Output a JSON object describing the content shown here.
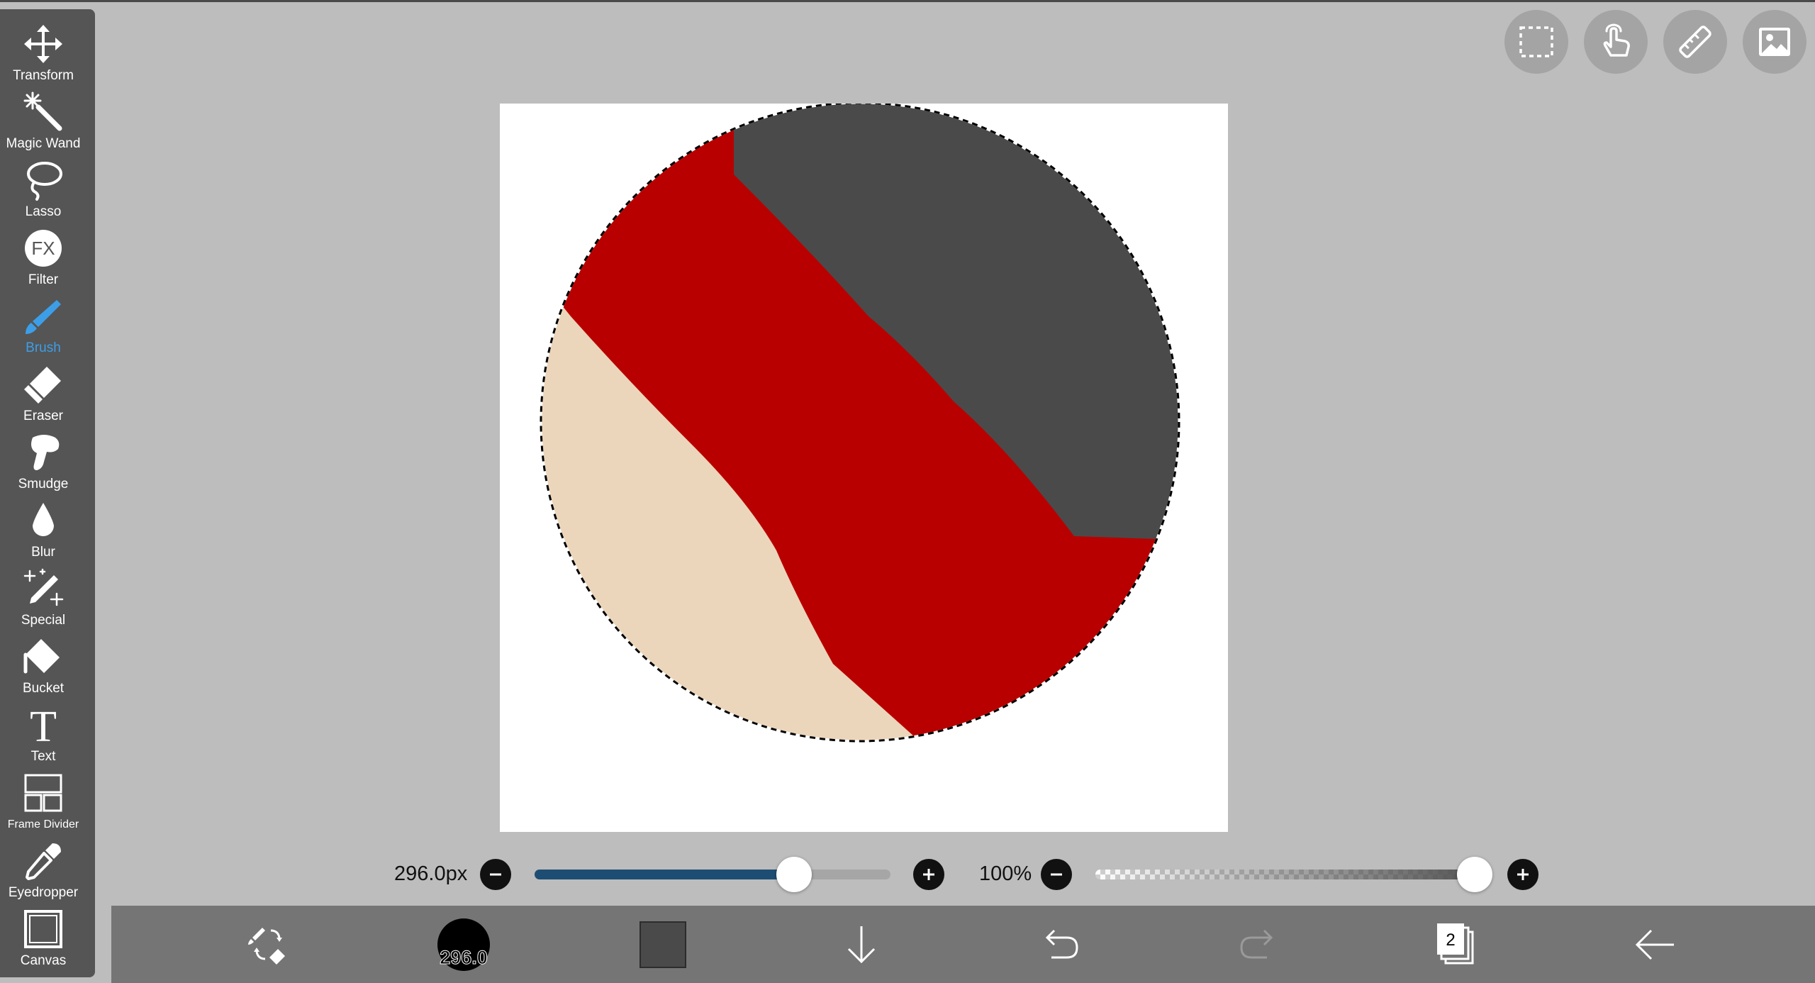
{
  "toolbar": {
    "tools": [
      {
        "label": "Transform",
        "icon": "move-arrows-icon"
      },
      {
        "label": "Magic Wand",
        "icon": "magic-wand-icon"
      },
      {
        "label": "Lasso",
        "icon": "lasso-icon"
      },
      {
        "label": "Filter",
        "icon": "fx-filter-icon"
      },
      {
        "label": "Brush",
        "icon": "brush-icon"
      },
      {
        "label": "Eraser",
        "icon": "eraser-icon"
      },
      {
        "label": "Smudge",
        "icon": "smudge-finger-icon"
      },
      {
        "label": "Blur",
        "icon": "blur-drop-icon"
      },
      {
        "label": "Special",
        "icon": "special-sparkle-pen-icon"
      },
      {
        "label": "Bucket",
        "icon": "paint-bucket-icon"
      },
      {
        "label": "Text",
        "icon": "text-t-icon"
      },
      {
        "label": "Frame Divider",
        "icon": "frame-divider-icon"
      },
      {
        "label": "Eyedropper",
        "icon": "eyedropper-icon"
      },
      {
        "label": "Canvas",
        "icon": "canvas-frame-icon"
      }
    ],
    "active_tool": "Brush",
    "filter_icon_text": "FX",
    "text_icon_text": "T"
  },
  "top_buttons": [
    {
      "icon": "selection-rect-icon"
    },
    {
      "icon": "hand-touch-icon"
    },
    {
      "icon": "ruler-icon"
    },
    {
      "icon": "image-icon"
    }
  ],
  "canvas": {
    "background": "#ffffff",
    "colors": {
      "dark_gray": "#4a4a4a",
      "red": "#b90000",
      "beige": "#ecd6bb"
    }
  },
  "brush_settings": {
    "size_value": "296.0px",
    "size_fraction": 0.73,
    "opacity_value": "100%",
    "opacity_fraction": 1.0
  },
  "bottom_bar": {
    "brush_size_preview": "296.0",
    "current_color": "#4a4a4a",
    "layer_count": "2",
    "icons": [
      "swap-brush-eraser-icon",
      "brush-preview",
      "color-swatch",
      "download-arrow-icon",
      "undo-icon",
      "redo-icon",
      "layers-icon",
      "back-arrow-icon"
    ]
  },
  "accent_color": "#3d9ee8",
  "slider_fill_color": "#1e4d73"
}
